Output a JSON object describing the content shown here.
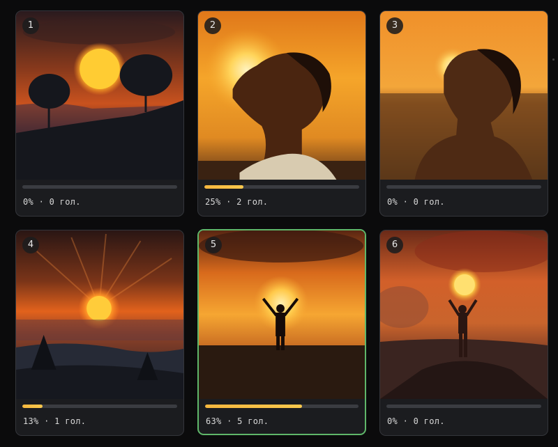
{
  "gallery": {
    "items": [
      {
        "number": "1",
        "progress": 0,
        "status": "0% · 0 гол.",
        "selected": false,
        "image": "sunset-trees-hill"
      },
      {
        "number": "2",
        "progress": 25,
        "status": "25% · 2 гол.",
        "selected": false,
        "image": "boy-face-to-sun"
      },
      {
        "number": "3",
        "progress": 0,
        "status": "0% · 0 гол.",
        "selected": false,
        "image": "woman-face-to-sun"
      },
      {
        "number": "4",
        "progress": 13,
        "status": "13% · 1 гол.",
        "selected": false,
        "image": "sun-rays-over-hills"
      },
      {
        "number": "5",
        "progress": 63,
        "status": "63% · 5 гол.",
        "selected": true,
        "image": "man-arms-raised-sunset"
      },
      {
        "number": "6",
        "progress": 0,
        "status": "0% · 0 гол.",
        "selected": false,
        "image": "man-arms-raised-red-sky"
      }
    ]
  },
  "colors": {
    "background": "#0b0b0c",
    "card": "#1b1c1f",
    "selected_border": "#5fb76a",
    "progress_fill": "#f5b73e",
    "progress_track": "#3a3c41"
  }
}
